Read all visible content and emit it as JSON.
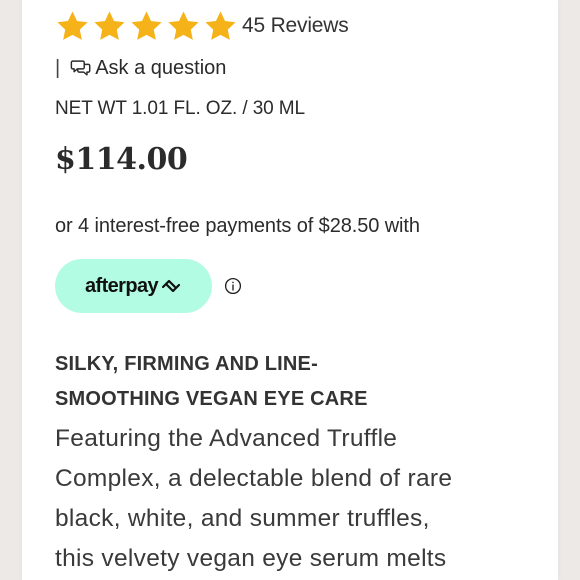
{
  "rating": {
    "stars": 5,
    "reviews_label": "45 Reviews",
    "star_color": "#f5b319"
  },
  "question": {
    "separator": "|",
    "label": "Ask a question"
  },
  "product": {
    "net_weight": "NET WT 1.01 FL. OZ. / 30 ML",
    "price": "$114.00"
  },
  "payment": {
    "installments_text": "or 4 interest-free payments of $28.50 with",
    "provider_label": "afterpay",
    "provider_color": "#b2fce4"
  },
  "description": {
    "headline_line1": "SILKY, FIRMING AND LINE-",
    "headline_line2": "SMOOTHING VEGAN EYE CARE",
    "body_lines": [
      "Featuring the Advanced Truffle",
      "Complex, a delectable blend of rare",
      "black, white, and summer truffles,",
      "this velvety vegan eye serum melts"
    ]
  },
  "icons": {
    "star": "star-icon",
    "question": "chat-bubbles-icon",
    "afterpay_logo": "afterpay-arrows-icon",
    "info": "info-icon"
  }
}
